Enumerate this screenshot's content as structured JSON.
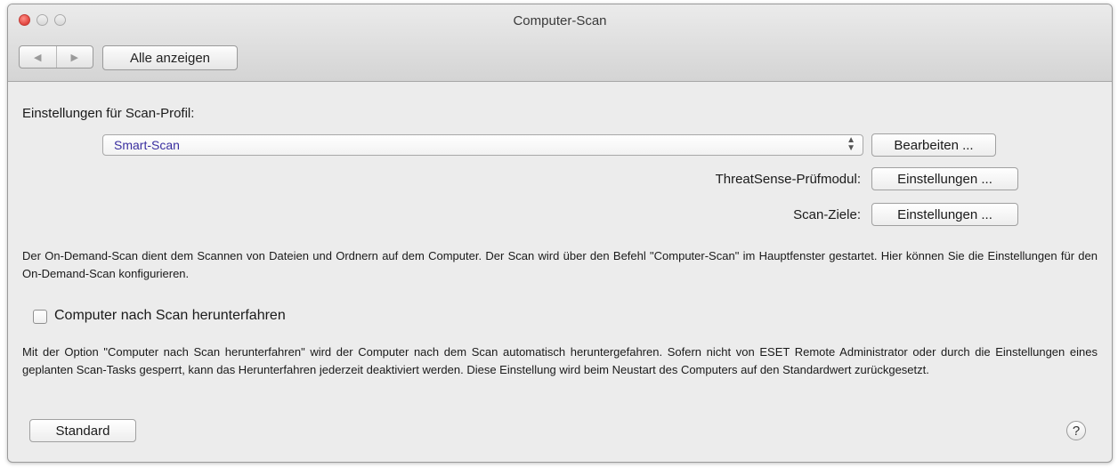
{
  "window": {
    "title": "Computer-Scan"
  },
  "toolbar": {
    "back_glyph": "◀",
    "forward_glyph": "▶",
    "show_all_label": "Alle anzeigen"
  },
  "profile": {
    "heading": "Einstellungen für Scan-Profil:",
    "selected": "Smart-Scan",
    "edit_label": "Bearbeiten ...",
    "threatsense_label": "ThreatSense-Prüfmodul:",
    "threatsense_button": "Einstellungen ...",
    "targets_label": "Scan-Ziele:",
    "targets_button": "Einstellungen ..."
  },
  "description": "Der On-Demand-Scan dient dem Scannen von Dateien und Ordnern auf dem Computer. Der Scan wird über den Befehl \"Computer-Scan\" im Hauptfenster gestartet. Hier können Sie die Einstellungen für den On-Demand-Scan konfigurieren.",
  "shutdown": {
    "checkbox_label": "Computer nach Scan herunterfahren",
    "checked": false,
    "description": "Mit der Option \"Computer nach Scan herunterfahren\" wird der Computer nach dem Scan automatisch heruntergefahren. Sofern nicht von ESET Remote Administrator oder durch die Einstellungen eines geplanten Scan-Tasks gesperrt, kann das Herunterfahren jederzeit deaktiviert werden. Diese Einstellung wird beim Neustart des Computers auf den Standardwert zurückgesetzt."
  },
  "footer": {
    "default_label": "Standard",
    "help_glyph": "?"
  },
  "colors": {
    "close_button": "#e0443e",
    "selected_value": "#3a2fa0"
  }
}
